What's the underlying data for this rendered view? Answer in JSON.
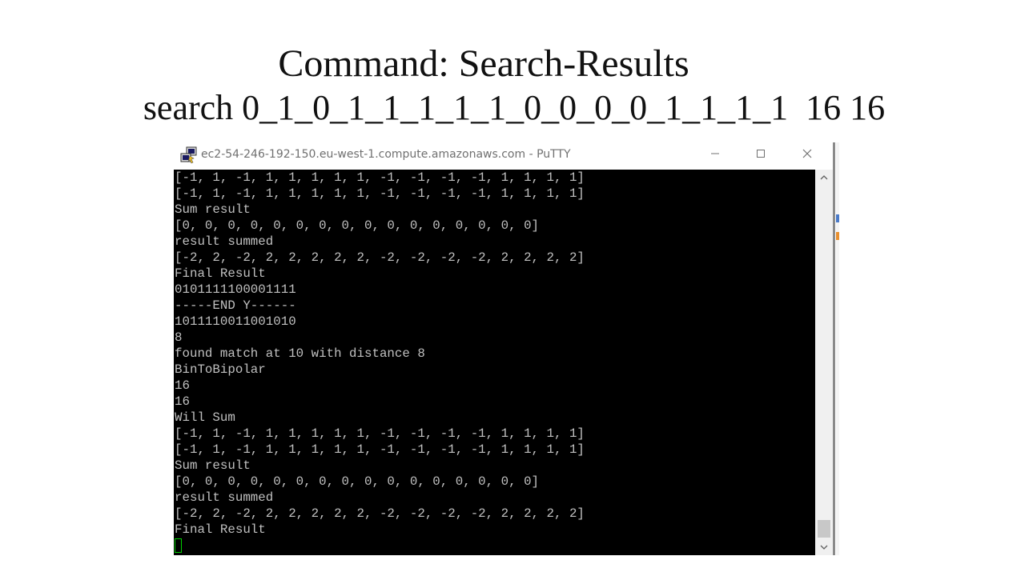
{
  "slide": {
    "title": "Command: Search-Results",
    "subtitle": "search 0_1_0_1_1_1_1_1_0_0_0_0_1_1_1_1  16 16"
  },
  "window": {
    "title": "ec2-54-246-192-150.eu-west-1.compute.amazonaws.com - PuTTY",
    "app_icon": "putty-icon",
    "controls": {
      "minimize": "minimize-icon",
      "maximize": "maximize-icon",
      "close": "close-icon"
    }
  },
  "terminal": {
    "lines": [
      "[-1, 1, -1, 1, 1, 1, 1, 1, -1, -1, -1, -1, 1, 1, 1, 1]",
      "[-1, 1, -1, 1, 1, 1, 1, 1, -1, -1, -1, -1, 1, 1, 1, 1]",
      "Sum result",
      "[0, 0, 0, 0, 0, 0, 0, 0, 0, 0, 0, 0, 0, 0, 0, 0]",
      "result summed",
      "[-2, 2, -2, 2, 2, 2, 2, 2, -2, -2, -2, -2, 2, 2, 2, 2]",
      "Final Result",
      "0101111100001111",
      "-----END Y------",
      "1011110011001010",
      "8",
      "found match at 10 with distance 8",
      "BinToBipolar",
      "16",
      "16",
      "Will Sum",
      "[-1, 1, -1, 1, 1, 1, 1, 1, -1, -1, -1, -1, 1, 1, 1, 1]",
      "[-1, 1, -1, 1, 1, 1, 1, 1, -1, -1, -1, -1, 1, 1, 1, 1]",
      "Sum result",
      "[0, 0, 0, 0, 0, 0, 0, 0, 0, 0, 0, 0, 0, 0, 0, 0]",
      "result summed",
      "[-2, 2, -2, 2, 2, 2, 2, 2, -2, -2, -2, -2, 2, 2, 2, 2]",
      "Final Result"
    ],
    "cursor_color": "#00d000"
  },
  "colors": {
    "terminal_bg": "#000000",
    "terminal_fg": "#c0c0c0"
  }
}
